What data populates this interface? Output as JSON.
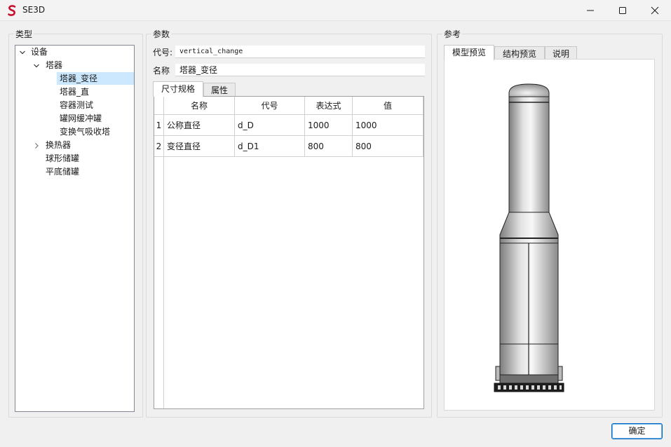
{
  "window": {
    "title": "SE3D"
  },
  "type_panel": {
    "label": "类型",
    "tree": [
      {
        "label": "设备",
        "expanded": true
      },
      {
        "label": "塔器",
        "expanded": true
      },
      {
        "label": "塔器_变径",
        "selected": true
      },
      {
        "label": "塔器_直"
      },
      {
        "label": "容器测试"
      },
      {
        "label": "罐网缓冲罐"
      },
      {
        "label": "变换气吸收塔"
      },
      {
        "label": "换热器",
        "expanded": false
      },
      {
        "label": "球形储罐"
      },
      {
        "label": "平底储罐"
      }
    ]
  },
  "params_panel": {
    "label": "参数",
    "code_label": "代号:",
    "code_value": "vertical_change",
    "name_label": "名称",
    "name_value": "塔器_变径",
    "tabs": [
      "尺寸规格",
      "属性"
    ],
    "active_tab": "尺寸规格",
    "table": {
      "headers": [
        "名称",
        "代号",
        "表达式",
        "值"
      ],
      "rows": [
        {
          "num": "1",
          "name": "公称直径",
          "code": "d_D",
          "expr": "1000",
          "value": "1000"
        },
        {
          "num": "2",
          "name": "变径直径",
          "code": "d_D1",
          "expr": "800",
          "value": "800"
        }
      ]
    }
  },
  "ref_panel": {
    "label": "参考",
    "tabs": [
      "模型预览",
      "结构预览",
      "说明"
    ],
    "active_tab": "模型预览"
  },
  "ok_button": "确定",
  "colors": {
    "selection": "#cce8ff",
    "accent": "#0067c0",
    "logo_red": "#c8102e"
  }
}
